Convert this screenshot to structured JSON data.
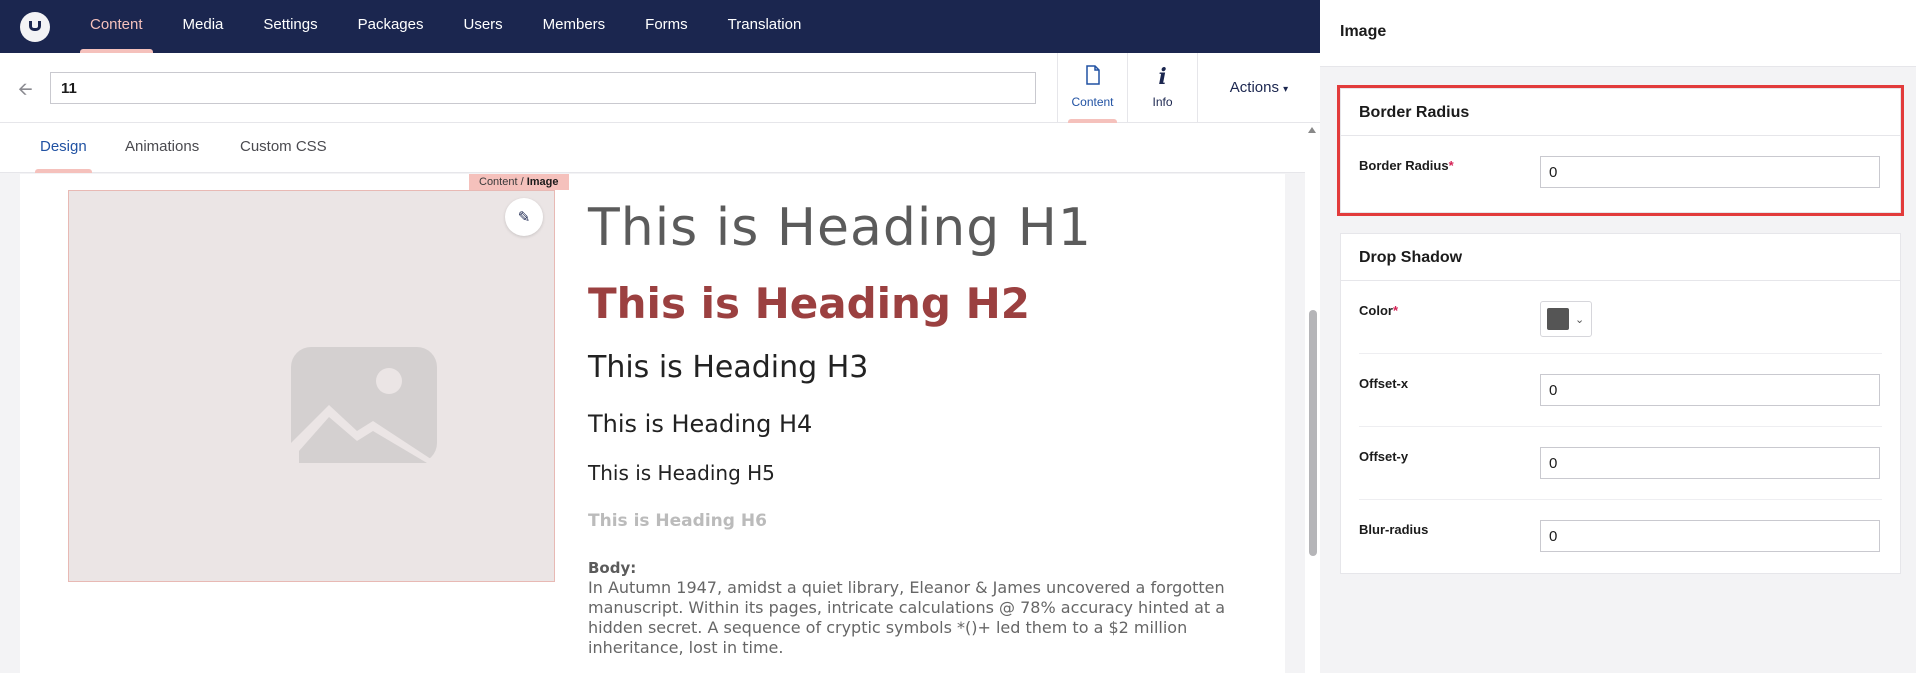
{
  "nav": {
    "items": [
      {
        "label": "Content",
        "active": true
      },
      {
        "label": "Media"
      },
      {
        "label": "Settings"
      },
      {
        "label": "Packages"
      },
      {
        "label": "Users"
      },
      {
        "label": "Members"
      },
      {
        "label": "Forms"
      },
      {
        "label": "Translation"
      }
    ]
  },
  "editor": {
    "name_value": "11",
    "apps": {
      "content_label": "Content",
      "info_label": "Info"
    },
    "actions_label": "Actions",
    "tabs": [
      "Design",
      "Animations",
      "Custom CSS"
    ]
  },
  "canvas": {
    "breadcrumb_parent": "Content / ",
    "breadcrumb_current": "Image",
    "headings": {
      "h1": "This is Heading H1",
      "h2": "This is Heading H2",
      "h3": "This is Heading H3",
      "h4": "This is Heading H4",
      "h5": "This is Heading H5",
      "h6": "This is Heading H6"
    },
    "body_label": "Body:",
    "body_text": "In Autumn 1947, amidst a quiet library, Eleanor & James uncovered a forgotten manuscript. Within its pages, intricate calculations @ 78% accuracy hinted at a hidden secret. A sequence of cryptic symbols *()+ led them to a $2 million inheritance, lost in time."
  },
  "panel": {
    "title": "Image",
    "border_radius": {
      "title": "Border Radius",
      "label": "Border Radius",
      "required_mark": "*",
      "value": "0"
    },
    "drop_shadow": {
      "title": "Drop Shadow",
      "color_label": "Color",
      "required_mark": "*",
      "color_value": "#555555",
      "offset_x_label": "Offset-x",
      "offset_x_value": "0",
      "offset_y_label": "Offset-y",
      "offset_y_value": "0",
      "blur_label": "Blur-radius",
      "blur_value": "0"
    }
  },
  "colors": {
    "nav_bg": "#1b264f",
    "accent_pink": "#f5c1bc",
    "link_blue": "#2152a3",
    "h2_color": "#9b4040",
    "highlight_red": "#e23b3b"
  }
}
